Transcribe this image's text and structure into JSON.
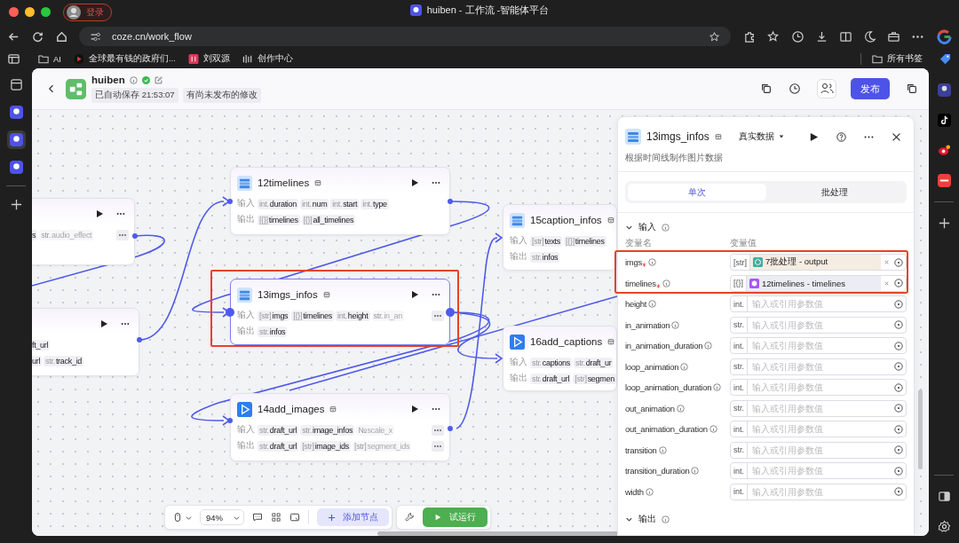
{
  "browser": {
    "profile_label": "登录",
    "tab_title": "huiben - 工作流 -智能体平台",
    "url": "coze.cn/work_flow",
    "bookmarks": [
      {
        "label": "AI",
        "kind": "folder"
      },
      {
        "label": "全球最有钱的政府们...",
        "kind": "video"
      },
      {
        "label": "刘双源",
        "kind": "app"
      },
      {
        "label": "创作中心",
        "kind": "bars"
      }
    ],
    "all_bookmarks": "所有书签"
  },
  "header": {
    "title": "huiben",
    "tags": [
      "已自动保存 21:53:07",
      "有尚未发布的修改"
    ],
    "publish": "发布"
  },
  "canvas": {
    "nodes": [
      {
        "kind": "cut",
        "selected": false,
        "highlighted": false,
        "inputs": [
          {
            "name": "s"
          },
          {
            "type": "str.",
            "name": "audio_effect",
            "faded": true
          }
        ],
        "input_more": true
      },
      {
        "kind": "cut",
        "selected": false,
        "highlighted": false,
        "inputs": [
          {
            "name": "ft_url"
          }
        ],
        "outputs": [
          {
            "name": "url"
          },
          {
            "type": "str.",
            "name": "track_id"
          }
        ]
      },
      {
        "kind": "code",
        "title": "12timelines",
        "selected": false,
        "highlighted": false,
        "input_label": "输入",
        "output_label": "输出",
        "inputs": [
          {
            "type": "int.",
            "name": "duration"
          },
          {
            "type": "int.",
            "name": "num"
          },
          {
            "type": "int.",
            "name": "start"
          },
          {
            "type": "int.",
            "name": "type"
          }
        ],
        "outputs": [
          {
            "type": "[{}]",
            "name": "timelines"
          },
          {
            "type": "[{}]",
            "name": "all_timelines"
          }
        ]
      },
      {
        "kind": "code",
        "title": "13imgs_infos",
        "selected": true,
        "highlighted": true,
        "input_label": "输入",
        "output_label": "输出",
        "inputs": [
          {
            "type": "[str]",
            "name": "imgs"
          },
          {
            "type": "[{}]",
            "name": "timelines"
          },
          {
            "type": "int.",
            "name": "height"
          },
          {
            "type": "str.",
            "name": "in_an",
            "faded": true
          }
        ],
        "input_more": true,
        "outputs": [
          {
            "type": "str.",
            "name": "infos"
          }
        ]
      },
      {
        "kind": "plugin",
        "title": "14add_images",
        "selected": false,
        "highlighted": false,
        "input_label": "输入",
        "output_label": "输出",
        "inputs": [
          {
            "type": "str.",
            "name": "draft_url"
          },
          {
            "type": "str.",
            "name": "image_infos"
          },
          {
            "type": "№",
            "name": "scale_x",
            "faded": true
          }
        ],
        "input_more": true,
        "outputs": [
          {
            "type": "str.",
            "name": "draft_url"
          },
          {
            "type": "[str]",
            "name": "image_ids"
          },
          {
            "type": "[str]",
            "name": "segment_ids",
            "faded": true
          }
        ],
        "output_more": true
      },
      {
        "kind": "code",
        "title": "15caption_infos",
        "selected": false,
        "highlighted": false,
        "input_label": "输入",
        "output_label": "输出",
        "inputs": [
          {
            "type": "[str]",
            "name": "texts"
          },
          {
            "type": "[{}]",
            "name": "timelines"
          }
        ],
        "outputs": [
          {
            "type": "str.",
            "name": "infos"
          }
        ]
      },
      {
        "kind": "plugin",
        "title": "16add_captions",
        "selected": false,
        "highlighted": false,
        "input_label": "输入",
        "output_label": "输出",
        "inputs": [
          {
            "type": "str.",
            "name": "captions"
          },
          {
            "type": "str.",
            "name": "draft_ur"
          }
        ],
        "outputs": [
          {
            "type": "str.",
            "name": "draft_url"
          },
          {
            "type": "[str]",
            "name": "segmen"
          }
        ]
      }
    ],
    "zoom": "94%",
    "add_node": "添加节点",
    "test_run": "试运行"
  },
  "panel": {
    "title": "13imgs_infos",
    "data_mode": "真实数据",
    "description": "根据时间线制作图片数据",
    "modes": [
      {
        "label": "单次",
        "selected": true
      },
      {
        "label": "批处理",
        "selected": false
      }
    ],
    "input_section": "输入",
    "col_name": "变量名",
    "col_value": "变量值",
    "param_groups": [
      {
        "highlighted": true,
        "rows": [
          {
            "name": "imgs",
            "required": true,
            "type": "[str]",
            "ref": {
              "label": "7批处理 - output",
              "kind": "batch"
            }
          },
          {
            "name": "timelines",
            "required": true,
            "type": "[{}]",
            "ref": {
              "label": "12timelines - timelines",
              "kind": "code"
            }
          }
        ]
      },
      {
        "highlighted": false,
        "rows": [
          {
            "name": "height",
            "required": false,
            "type": "int.",
            "placeholder": "输入或引用参数值"
          },
          {
            "name": "in_animation",
            "required": false,
            "type": "str.",
            "placeholder": "输入或引用参数值"
          },
          {
            "name": "in_animation_duration",
            "required": false,
            "type": "int.",
            "placeholder": "输入或引用参数值"
          },
          {
            "name": "loop_animation",
            "required": false,
            "type": "str.",
            "placeholder": "输入或引用参数值"
          },
          {
            "name": "loop_animation_duration",
            "required": false,
            "type": "int.",
            "placeholder": "输入或引用参数值"
          },
          {
            "name": "out_animation",
            "required": false,
            "type": "str.",
            "placeholder": "输入或引用参数值"
          },
          {
            "name": "out_animation_duration",
            "required": false,
            "type": "int.",
            "placeholder": "输入或引用参数值"
          },
          {
            "name": "transition",
            "required": false,
            "type": "str.",
            "placeholder": "输入或引用参数值"
          },
          {
            "name": "transition_duration",
            "required": false,
            "type": "int.",
            "placeholder": "输入或引用参数值"
          },
          {
            "name": "width",
            "required": false,
            "type": "int.",
            "placeholder": "输入或引用参数值"
          }
        ]
      }
    ],
    "output_section": "输出"
  }
}
